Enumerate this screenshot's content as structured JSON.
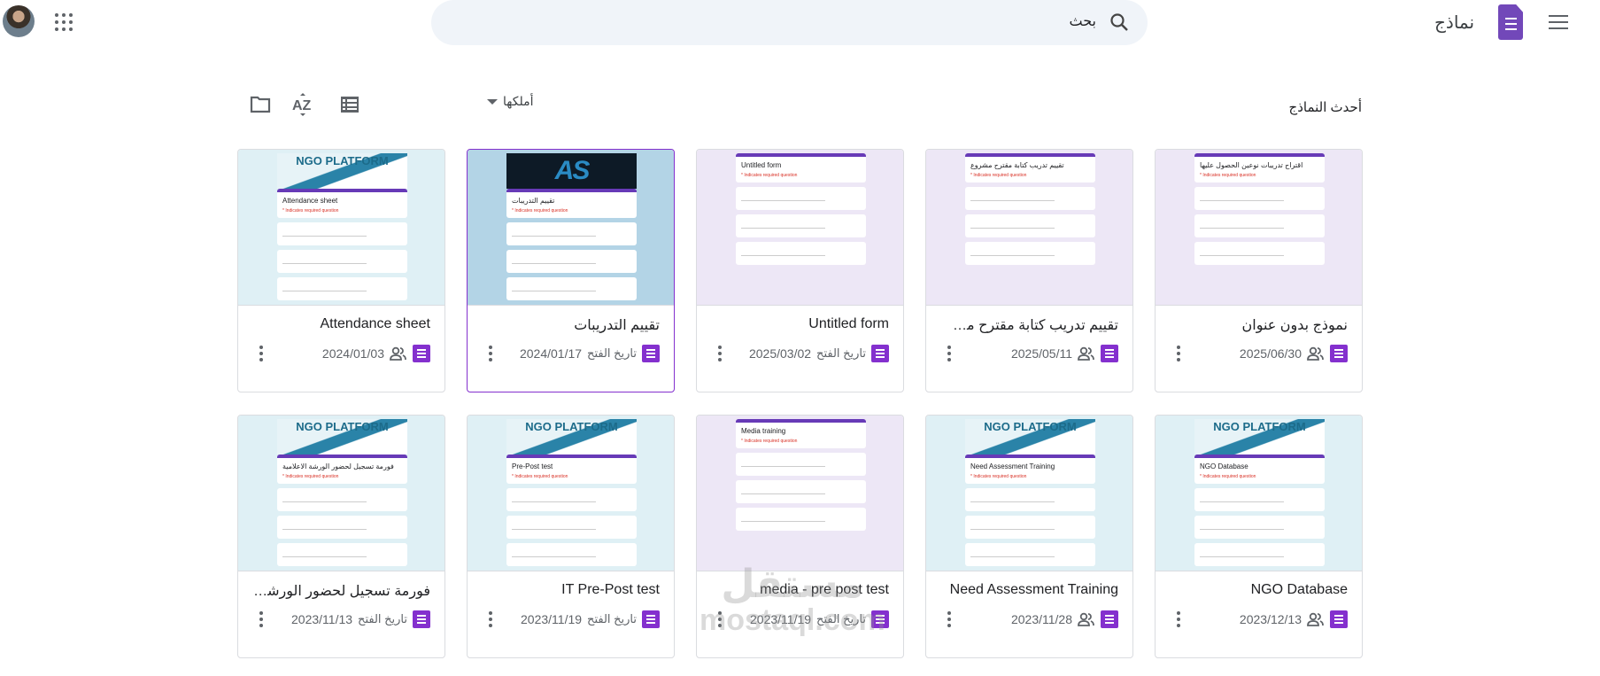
{
  "header": {
    "app_title": "نماذج",
    "search_placeholder": "بحث"
  },
  "toolbar": {
    "section_title": "أحدث النماذج",
    "owner_filter": "أملكها"
  },
  "opened_label": "تاريخ الفتح",
  "colors": {
    "accent": "#8430ce",
    "forms_logo": "#7248b9",
    "search_bg": "#f0f4f9"
  },
  "cards": [
    {
      "title": "نموذج بدون عنوان",
      "date": "2025/06/30",
      "shared": true,
      "thumb": {
        "bg": "#ede7f6",
        "banner": "none",
        "form_title": "اقتراح تدريبات نوعين الحصول عليها"
      }
    },
    {
      "title": "تقييم تدريب كتابة مقترح مشروع",
      "date": "2025/05/11",
      "shared": true,
      "thumb": {
        "bg": "#ede7f6",
        "banner": "none",
        "form_title": "تقييم تدريب كتابة مقترح مشروع"
      }
    },
    {
      "title": "Untitled form",
      "date": "2025/03/02",
      "shared": false,
      "thumb": {
        "bg": "#ede7f6",
        "banner": "none",
        "form_title": "Untitled form"
      }
    },
    {
      "title": "تقييم التدريبات",
      "date": "2024/01/17",
      "shared": false,
      "selected": true,
      "thumb": {
        "bg": "#b3d4e6",
        "banner": "ass",
        "banner_text": "AS",
        "form_title": "تقييم التدريبات"
      }
    },
    {
      "title": "Attendance sheet",
      "date": "2024/01/03",
      "shared": true,
      "thumb": {
        "bg": "#dff0f5",
        "banner": "ngo",
        "banner_text": "NGO PLATFORM",
        "form_title": "Attendance sheet"
      }
    },
    {
      "title": "NGO Database",
      "date": "2023/12/13",
      "shared": true,
      "thumb": {
        "bg": "#dff0f5",
        "banner": "ngo",
        "banner_text": "NGO PLATFORM",
        "form_title": "NGO Database"
      }
    },
    {
      "title": "Need Assessment Training",
      "date": "2023/11/28",
      "shared": true,
      "thumb": {
        "bg": "#dff0f5",
        "banner": "ngo",
        "banner_text": "NGO PLATFORM",
        "form_title": "Need Assessment Training"
      }
    },
    {
      "title": "media - pre post test",
      "date": "2023/11/19",
      "shared": false,
      "thumb": {
        "bg": "#ede7f6",
        "banner": "none",
        "form_title": "Media training"
      }
    },
    {
      "title": "IT Pre-Post test",
      "date": "2023/11/19",
      "shared": false,
      "thumb": {
        "bg": "#dff0f5",
        "banner": "ngo",
        "banner_text": "NGO PLATFORM",
        "form_title": "Pre-Post test"
      }
    },
    {
      "title": "فورمة تسجيل لحضور الورشة التدريبية",
      "date": "2023/11/13",
      "shared": false,
      "thumb": {
        "bg": "#dff0f5",
        "banner": "ngo",
        "banner_text": "NGO PLATFORM",
        "form_title": "فورمة تسجيل لحضور الورشة الاعلامية"
      }
    }
  ],
  "watermark": {
    "line1": "مستقل",
    "line2": "mostaql.com"
  }
}
